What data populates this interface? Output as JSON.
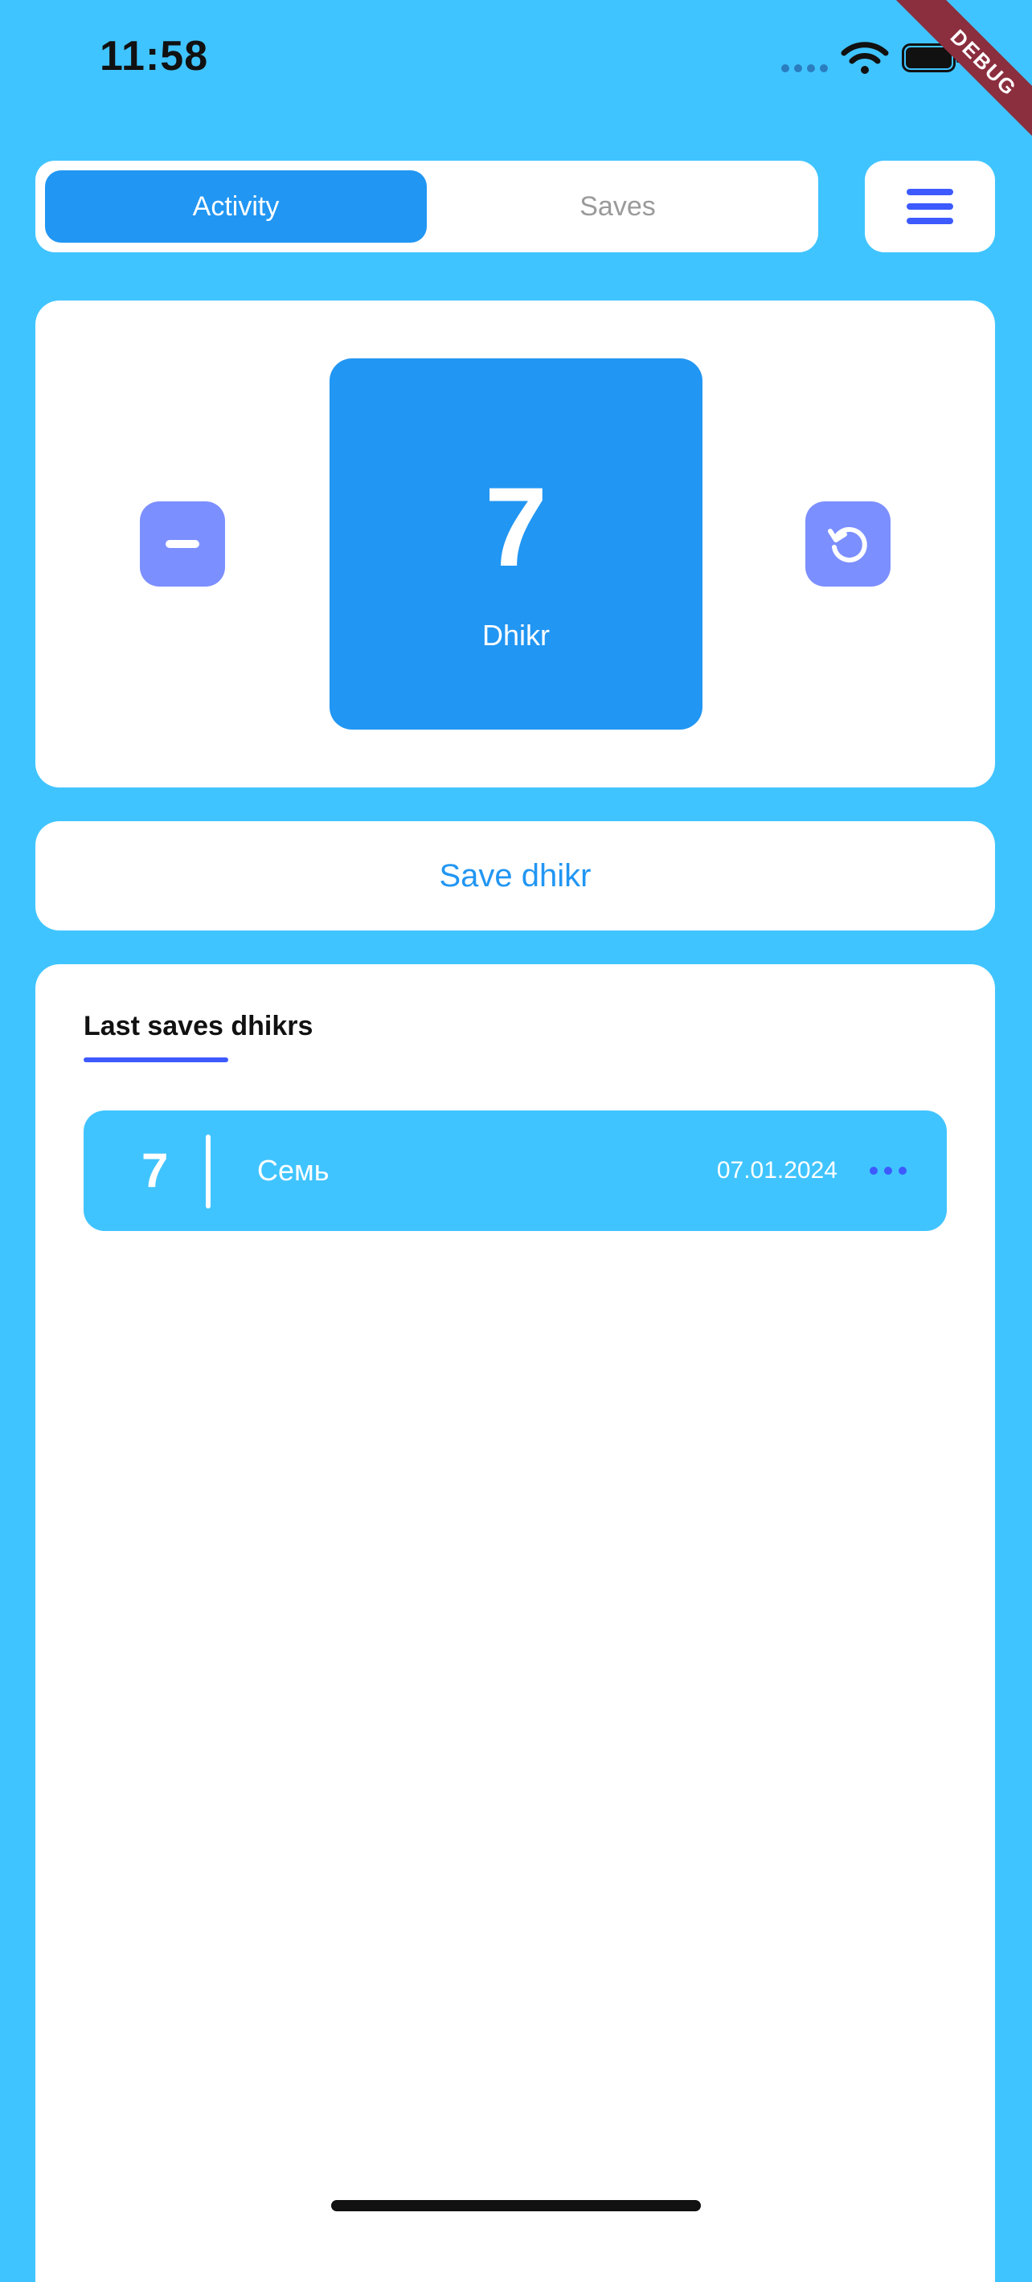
{
  "status_bar": {
    "time": "11:58"
  },
  "debug_banner": "DEBUG",
  "tabs": [
    {
      "label": "Activity",
      "active": true
    },
    {
      "label": "Saves",
      "active": false
    }
  ],
  "menu": {
    "icon": "hamburger-menu-icon"
  },
  "counter": {
    "value": "7",
    "label": "Dhikr"
  },
  "controls": {
    "decrement_icon": "minus-icon",
    "reset_icon": "reset-icon"
  },
  "save_button": {
    "label": "Save dhikr"
  },
  "last_saves": {
    "title": "Last saves dhikrs",
    "items": [
      {
        "count": "7",
        "name": "Семь",
        "date": "07.01.2024",
        "more_icon": "more-dots-icon"
      }
    ]
  },
  "colors": {
    "background": "#40C4FF",
    "primary": "#2196F3",
    "accent": "#3D5AFE",
    "button_soft": "#7C8FFF",
    "debug_ribbon": "#8B2E3E"
  }
}
